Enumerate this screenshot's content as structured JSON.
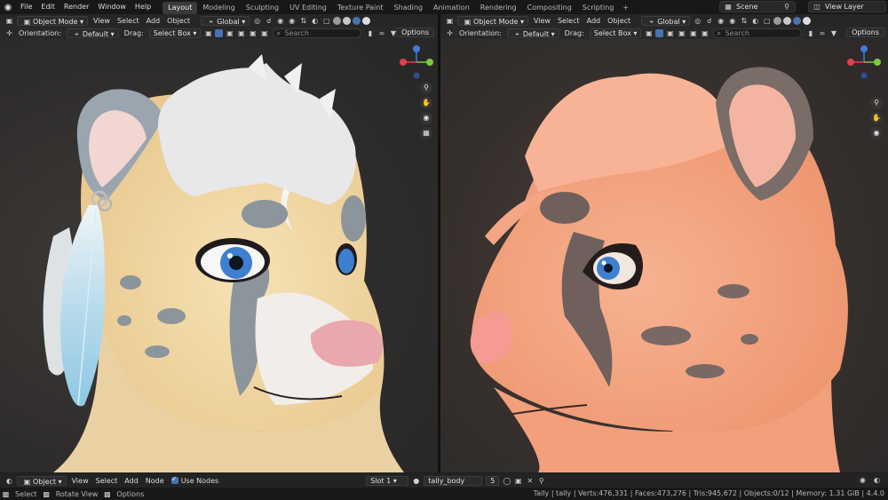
{
  "topbar": {
    "menus": [
      "File",
      "Edit",
      "Render",
      "Window",
      "Help"
    ],
    "workspaces": [
      "Layout",
      "Modeling",
      "Sculpting",
      "UV Editing",
      "Texture Paint",
      "Shading",
      "Animation",
      "Rendering",
      "Compositing",
      "Scripting"
    ],
    "active_workspace": "Layout",
    "add_workspace": "+",
    "scene_name": "Scene",
    "view_layer": "View Layer"
  },
  "viewport_header": {
    "mode": "Object Mode",
    "menus": [
      "View",
      "Select",
      "Add",
      "Object"
    ],
    "transform_orientation": "Global",
    "orientation_label": "Orientation:",
    "orientation_value": "Default",
    "drag_label": "Drag:",
    "drag_value": "Select Box",
    "search_placeholder": "Search",
    "options": "Options"
  },
  "node_editor_header": {
    "type": "Object",
    "menus": [
      "View",
      "Select",
      "Add",
      "Node"
    ],
    "use_nodes": "Use Nodes",
    "slot": "Slot 1",
    "material": "tally_body",
    "users": "5"
  },
  "statusbar": {
    "select": "Select",
    "rotate_view": "Rotate View",
    "options": "Options",
    "stats": "Tally | tally | Verts:476,331 | Faces:473,276 | Tris:945,672 | Objects:0/12 | Memory: 1.31 GiB | 4.4.0"
  },
  "colors": {
    "accent": "#4772b3",
    "active_tab": "#3a3a3a",
    "gizmo_x": "#e0404f",
    "gizmo_y": "#7ac943",
    "gizmo_z": "#3f7cd9",
    "left_fur": "#f3d9a6",
    "right_fur": "#f5a27e"
  }
}
